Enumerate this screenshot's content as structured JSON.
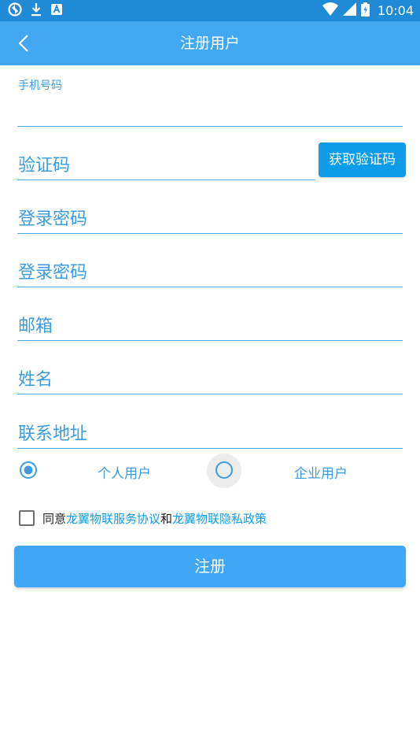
{
  "status_bar": {
    "time": "10:04",
    "icons": [
      "sync-icon",
      "download-icon",
      "app-notification-icon",
      "wifi-icon",
      "signal-icon",
      "battery-icon"
    ]
  },
  "app_bar": {
    "title": "注册用户",
    "back_icon": "chevron-left-icon"
  },
  "form": {
    "phone_label": "手机号码",
    "phone_value": "",
    "code_placeholder": "验证码",
    "get_code_button": "获取验证码",
    "password_placeholder": "登录密码",
    "confirm_password_placeholder": "登录密码",
    "email_placeholder": "邮箱",
    "name_placeholder": "姓名",
    "address_placeholder": "联系地址"
  },
  "user_type": {
    "options": [
      {
        "label": "个人用户",
        "selected": true
      },
      {
        "label": "企业用户",
        "selected": false
      }
    ]
  },
  "agreement": {
    "checked": false,
    "prefix": "同意",
    "service_link": "龙翼物联服务协议",
    "conjunction": "和",
    "privacy_link": "龙翼物联隐私政策"
  },
  "submit_label": "注册",
  "colors": {
    "status_bar": "#1f8ad6",
    "app_bar": "#42a8f2",
    "accent": "#3d9ce0",
    "button": "#3fa7f5",
    "link": "#0d9de8"
  }
}
